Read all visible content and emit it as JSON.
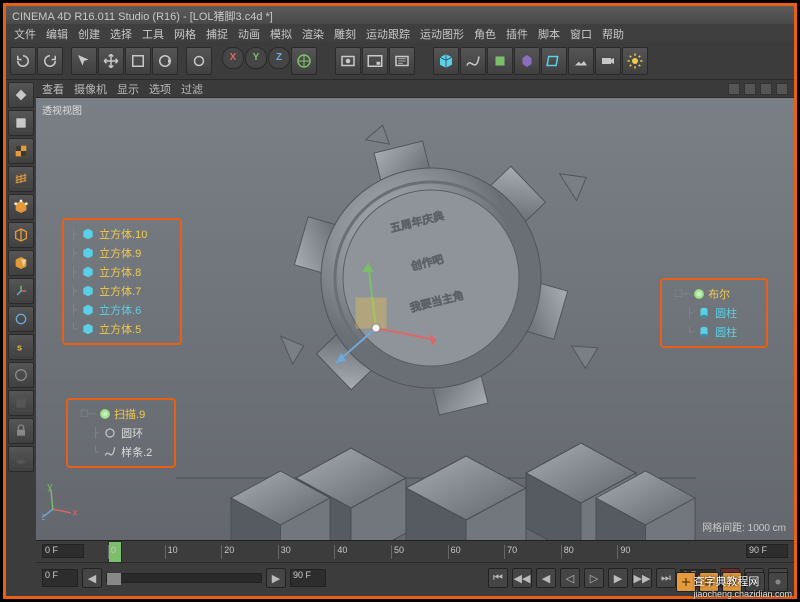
{
  "title": "CINEMA 4D R16.011 Studio (R16) - [LOL猪脚3.c4d *]",
  "menu": [
    "文件",
    "编辑",
    "创建",
    "选择",
    "工具",
    "网格",
    "捕捉",
    "动画",
    "模拟",
    "渲染",
    "雕刻",
    "运动跟踪",
    "运动图形",
    "角色",
    "插件",
    "脚本",
    "窗口",
    "帮助"
  ],
  "axes": {
    "x": "X",
    "y": "Y",
    "z": "Z"
  },
  "viewport_menu": [
    "查看",
    "摄像机",
    "显示",
    "选项",
    "过滤"
  ],
  "viewport_label": "透视视图",
  "grid_status": "网格间距: 1000 cm",
  "callout1": {
    "items": [
      {
        "label": "立方体.10",
        "color": "yel"
      },
      {
        "label": "立方体.9",
        "color": "yel"
      },
      {
        "label": "立方体.8",
        "color": "yel"
      },
      {
        "label": "立方体.7",
        "color": "yel"
      },
      {
        "label": "立方体.6",
        "color": "cyan"
      },
      {
        "label": "立方体.5",
        "color": "yel"
      }
    ]
  },
  "callout2": {
    "root": "扫描.9",
    "children": [
      {
        "label": "圆环",
        "shape": "circle"
      },
      {
        "label": "样条.2",
        "shape": "path"
      }
    ]
  },
  "callout3": {
    "root": "布尔",
    "children": [
      {
        "label": "圆柱"
      },
      {
        "label": "圆柱"
      }
    ]
  },
  "timeline": {
    "frame_start": "0 F",
    "frame_end": "90 F",
    "current": "0 F",
    "ticks": [
      "0",
      "10",
      "20",
      "30",
      "40",
      "50",
      "60",
      "70",
      "80",
      "90"
    ]
  },
  "watermark": {
    "main": "查字典教程网",
    "sub": "jiaocheng.chazidian.com"
  },
  "icons": {
    "undo": "undo",
    "redo": "redo",
    "arrow": "arrow",
    "move": "move",
    "rotate": "rotate",
    "scale": "scale",
    "cube": "cube",
    "render": "render",
    "world": "world"
  }
}
